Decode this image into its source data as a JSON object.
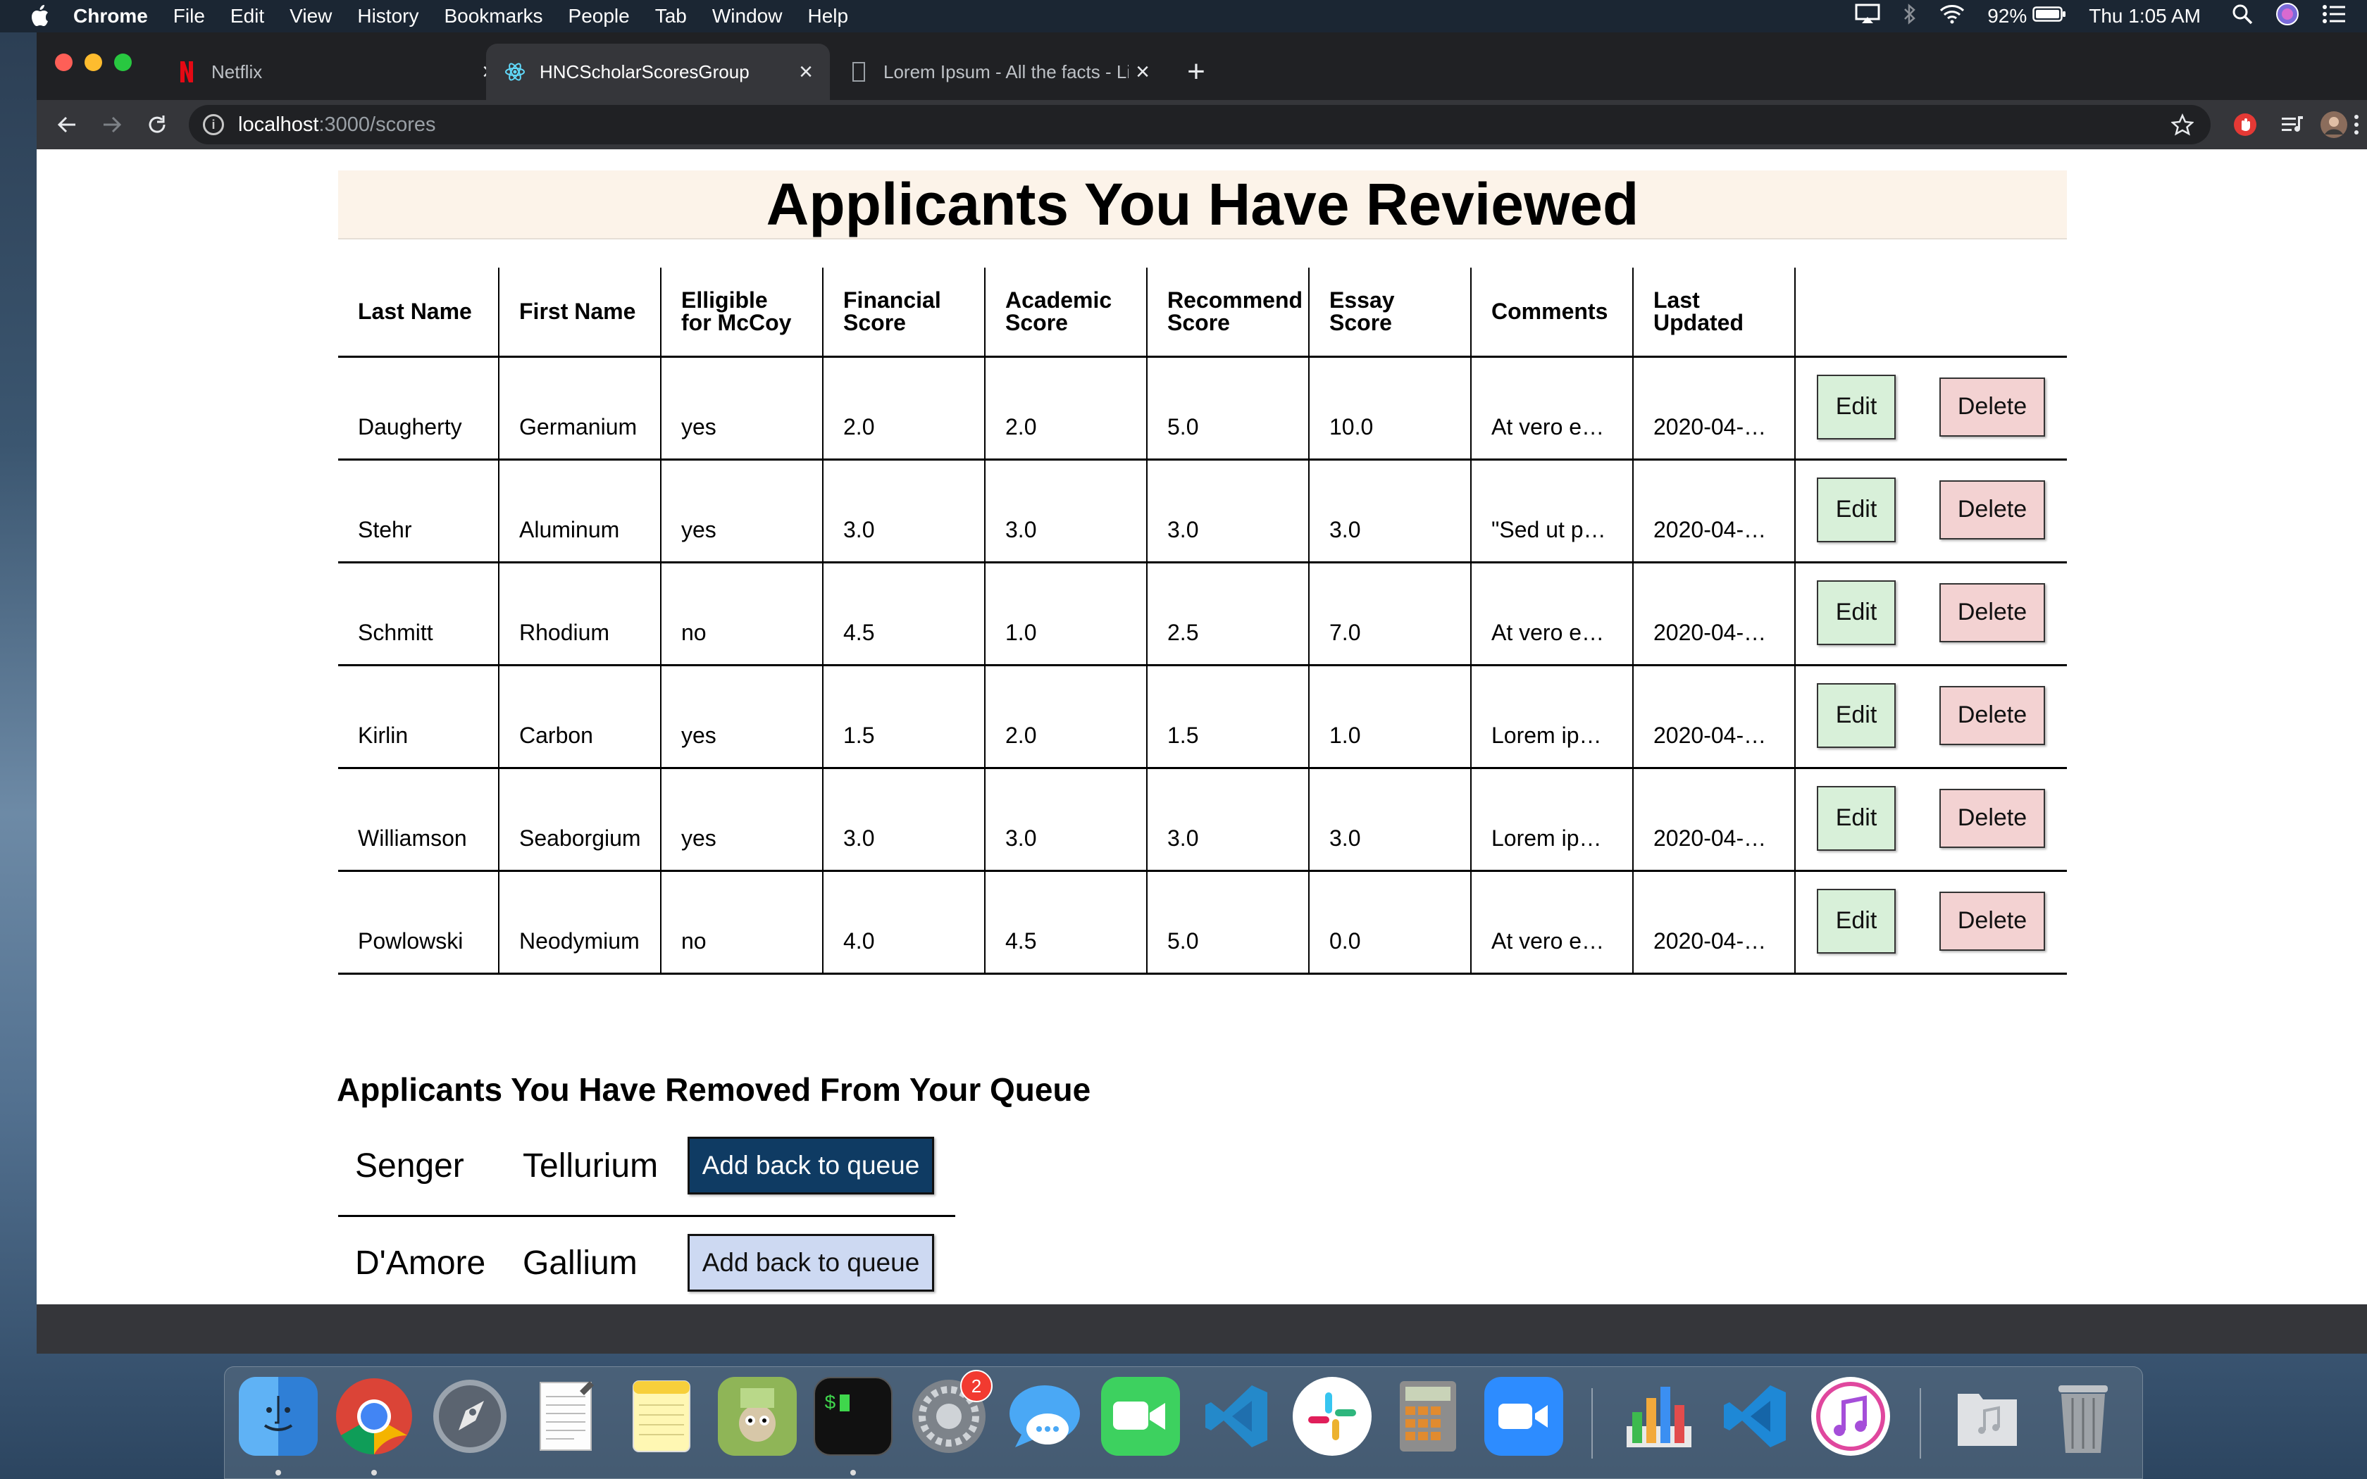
{
  "menubar": {
    "app": "Chrome",
    "items": [
      "File",
      "Edit",
      "View",
      "History",
      "Bookmarks",
      "People",
      "Tab",
      "Window",
      "Help"
    ],
    "battery": "92%",
    "clock": "Thu 1:05 AM"
  },
  "browser": {
    "tabs": [
      {
        "title": "Netflix",
        "icon": "netflix-icon"
      },
      {
        "title": "HNCScholarScoresGroup",
        "icon": "react-icon"
      },
      {
        "title": "Lorem Ipsum - All the facts - Li",
        "icon": "document-icon"
      }
    ],
    "url_host": "localhost",
    "url_path": ":3000/scores"
  },
  "page": {
    "title": "Applicants You Have Reviewed",
    "columns": [
      "Last Name",
      "First Name",
      "Elligible for McCoy",
      "Financial Score",
      "Academic Score",
      "Recommend Score",
      "Essay Score",
      "Comments",
      "Last Updated"
    ],
    "rows": [
      [
        "Daugherty",
        "Germanium",
        "yes",
        "2.0",
        "2.0",
        "5.0",
        "10.0",
        "At vero e…",
        "2020-04-…"
      ],
      [
        "Stehr",
        "Aluminum",
        "yes",
        "3.0",
        "3.0",
        "3.0",
        "3.0",
        "\"Sed ut p…",
        "2020-04-…"
      ],
      [
        "Schmitt",
        "Rhodium",
        "no",
        "4.5",
        "1.0",
        "2.5",
        "7.0",
        "At vero e…",
        "2020-04-…"
      ],
      [
        "Kirlin",
        "Carbon",
        "yes",
        "1.5",
        "2.0",
        "1.5",
        "1.0",
        "Lorem ip…",
        "2020-04-…"
      ],
      [
        "Williamson",
        "Seaborgium",
        "yes",
        "3.0",
        "3.0",
        "3.0",
        "3.0",
        "Lorem ip…",
        "2020-04-…"
      ],
      [
        "Powlowski",
        "Neodymium",
        "no",
        "4.0",
        "4.5",
        "5.0",
        "0.0",
        "At vero e…",
        "2020-04-…"
      ]
    ],
    "edit_label": "Edit",
    "delete_label": "Delete",
    "removed_title": "Applicants You Have Removed From Your Queue",
    "removed": [
      {
        "last": "Senger",
        "first": "Tellurium"
      },
      {
        "last": "D'Amore",
        "first": "Gallium"
      }
    ],
    "add_back_label": "Add back to queue"
  },
  "dock": {
    "apps": [
      "finder",
      "chrome",
      "launchpad",
      "textedit",
      "notes",
      "preview-character",
      "terminal",
      "system-preferences",
      "messages",
      "facetime",
      "vscode",
      "slack",
      "calculator",
      "zoom",
      "numbers",
      "vscode-insiders",
      "itunes",
      "music-folder",
      "trash"
    ],
    "system_preferences_badge": "2"
  },
  "colors": {
    "banner_bg": "#fcf3e9",
    "edit_bg": "#d8f0d9",
    "delete_bg": "#f3d2d2",
    "addback_dark": "#0f3b63",
    "addback_light": "#cdd9f2"
  }
}
